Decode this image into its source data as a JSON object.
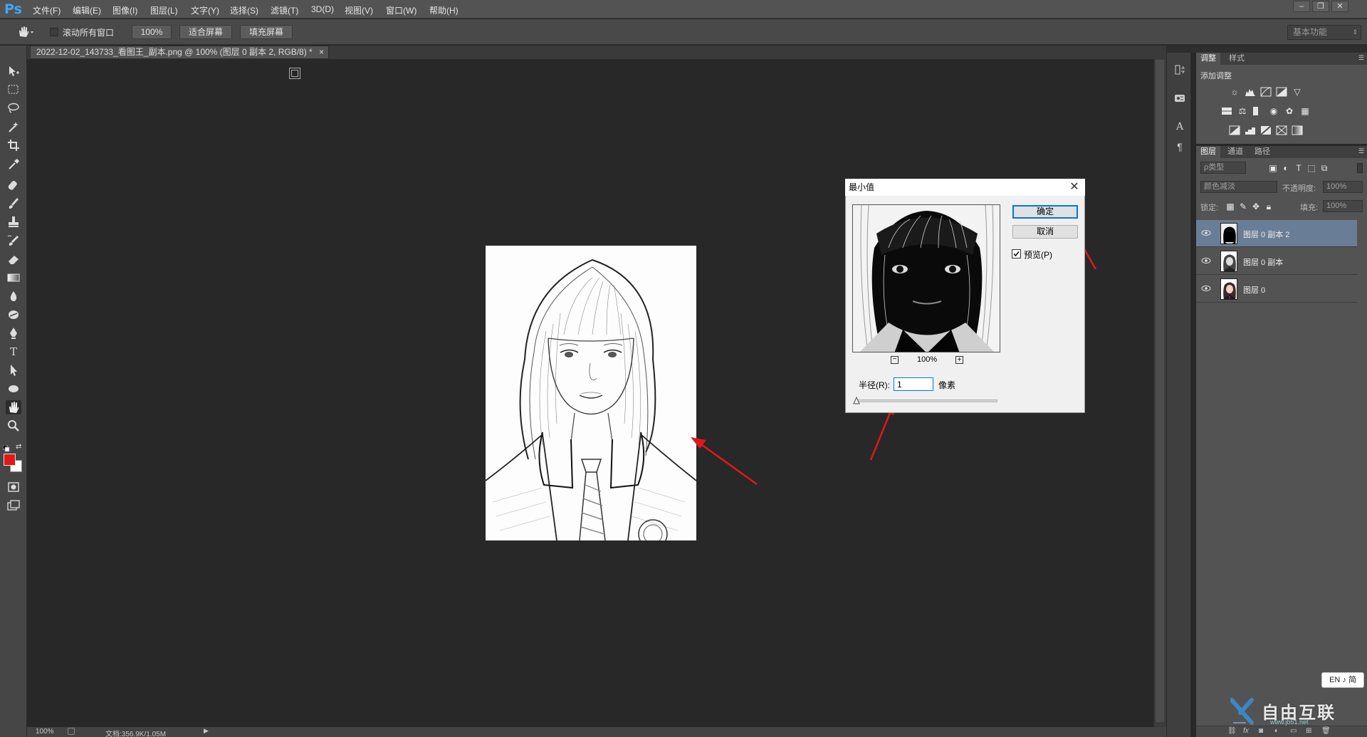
{
  "app": {
    "logo": "Ps"
  },
  "menu": [
    "文件(F)",
    "编辑(E)",
    "图像(I)",
    "图层(L)",
    "文字(Y)",
    "选择(S)",
    "滤镜(T)",
    "3D(D)",
    "视图(V)",
    "窗口(W)",
    "帮助(H)"
  ],
  "window_controls": [
    "–",
    "❐",
    "✕"
  ],
  "options": {
    "scroll_all_label": "滚动所有窗口",
    "zoom_button": "100%",
    "fit_screen_button": "适合屏幕",
    "fill_screen_button": "填充屏幕",
    "workspace": "基本功能"
  },
  "document": {
    "tab_title": "2022-12-02_143733_看图王_副本.png @ 100% (图层 0 副本 2, RGB/8) *",
    "tab_close": "×"
  },
  "status": {
    "zoom": "100%",
    "doc_size": "文档:356.9K/1.05M"
  },
  "dialog": {
    "title": "最小值",
    "close": "✕",
    "ok_button": "确定",
    "cancel_button": "取消",
    "preview_label": "预览(P)",
    "preview_checked": true,
    "zoom_out": "−",
    "zoom_level": "100%",
    "zoom_in": "+",
    "radius_label": "半径(R):",
    "radius_value": "1",
    "unit": "像素",
    "slider_fraction": 0.0
  },
  "right_panel": {
    "adj_tabs": [
      "调整",
      "样式"
    ],
    "add_adjustment": "添加调整",
    "layer_tabs": [
      "图层",
      "通道",
      "路径"
    ],
    "kind_filter": "ρ类型",
    "blend_mode": "颜色减淡",
    "opacity_label": "不透明度:",
    "opacity_value": "100%",
    "lock_label": "锁定:",
    "fill_label": "填充:",
    "fill_value": "100%",
    "layers": [
      {
        "name": "图层 0 副本 2",
        "selected": true
      },
      {
        "name": "图层 0 副本",
        "selected": false
      },
      {
        "name": "图层 0",
        "selected": false
      }
    ]
  },
  "ime": "EN ♪ 简",
  "watermark": {
    "text": "自由互联",
    "sub": "www.jb51.net"
  },
  "colors": {
    "foreground": "#e01818",
    "background": "#ffffff",
    "accent": "#0078d7",
    "arrow": "#e0181c",
    "layer_selected": "#6a7d96"
  }
}
